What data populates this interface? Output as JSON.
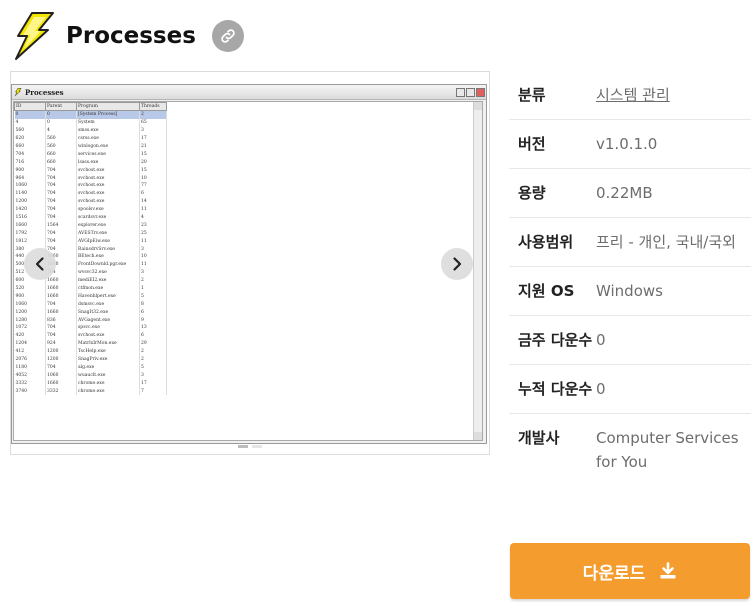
{
  "header": {
    "title": "Processes",
    "icon": "lightning-bolt-icon",
    "link_icon": "link-icon"
  },
  "screenshot": {
    "window_title": "Processes",
    "columns": [
      "ID",
      "Parent",
      "Program",
      "Threads"
    ],
    "rows": [
      [
        "0",
        "0",
        "[System Process]",
        "2"
      ],
      [
        "4",
        "0",
        "System",
        "65"
      ],
      [
        "560",
        "4",
        "smss.exe",
        "3"
      ],
      [
        "620",
        "560",
        "csrss.exe",
        "17"
      ],
      [
        "660",
        "560",
        "winlogon.exe",
        "21"
      ],
      [
        "704",
        "660",
        "services.exe",
        "15"
      ],
      [
        "716",
        "660",
        "lsass.exe",
        "20"
      ],
      [
        "900",
        "704",
        "svchost.exe",
        "15"
      ],
      [
        "964",
        "704",
        "svchost.exe",
        "10"
      ],
      [
        "1060",
        "704",
        "svchost.exe",
        "77"
      ],
      [
        "1140",
        "704",
        "svchost.exe",
        "6"
      ],
      [
        "1200",
        "704",
        "svchost.exe",
        "14"
      ],
      [
        "1420",
        "704",
        "spoolsv.exe",
        "11"
      ],
      [
        "1516",
        "704",
        "scardsvr.exe",
        "4"
      ],
      [
        "1660",
        "1564",
        "explorer.exe",
        "23"
      ],
      [
        "1792",
        "704",
        "AVESTrv.exe",
        "25"
      ],
      [
        "1812",
        "704",
        "AVGIpEiw.exe",
        "11"
      ],
      [
        "380",
        "704",
        "RainsdrvSrv.exe",
        "3"
      ],
      [
        "440",
        "1660",
        "BEtech.exe",
        "10"
      ],
      [
        "500",
        "1660",
        "FrontDownld.pgr.exe",
        "11"
      ],
      [
        "512",
        "704",
        "wvsvc32.exe",
        "3"
      ],
      [
        "600",
        "1660",
        "mediEI2.exe",
        "2"
      ],
      [
        "520",
        "1660",
        "ctfmon.exe",
        "1"
      ],
      [
        "900",
        "1660",
        "Havenhlpert.exe",
        "5"
      ],
      [
        "1060",
        "704",
        "dsmsvc.exe",
        "8"
      ],
      [
        "1200",
        "1660",
        "SnagIt32.exe",
        "6"
      ],
      [
        "1280",
        "836",
        "AVGagent.exe",
        "9"
      ],
      [
        "1072",
        "704",
        "spsvc.exe",
        "13"
      ],
      [
        "420",
        "704",
        "svchost.exe",
        "6"
      ],
      [
        "1204",
        "924",
        "MatrlxIrMon.exe",
        "29"
      ],
      [
        "412",
        "1200",
        "TscHelp.exe",
        "2"
      ],
      [
        "2076",
        "1200",
        "SnagPriv.exe",
        "2"
      ],
      [
        "1180",
        "704",
        "alg.exe",
        "5"
      ],
      [
        "4052",
        "1060",
        "wuauclt.exe",
        "3"
      ],
      [
        "3332",
        "1660",
        "chrome.exe",
        "17"
      ],
      [
        "3740",
        "3332",
        "chrome.exe",
        "7"
      ]
    ]
  },
  "info": {
    "rows": [
      {
        "key": "분류",
        "value": "시스템 관리",
        "link": true
      },
      {
        "key": "버전",
        "value": "v1.0.1.0"
      },
      {
        "key": "용량",
        "value": "0.22MB"
      },
      {
        "key": "사용범위",
        "value": "프리 - 개인, 국내/국외"
      },
      {
        "key": "지원 OS",
        "value": "Windows"
      },
      {
        "key": "금주 다운수",
        "value": "0"
      },
      {
        "key": "누적 다운수",
        "value": "0"
      },
      {
        "key": "개발사",
        "value": "Computer Services for You"
      }
    ]
  },
  "download": {
    "label": "다운로드",
    "icon": "download-icon"
  },
  "colors": {
    "accent": "#f59c2e",
    "link_bg": "#a7a7a7"
  }
}
